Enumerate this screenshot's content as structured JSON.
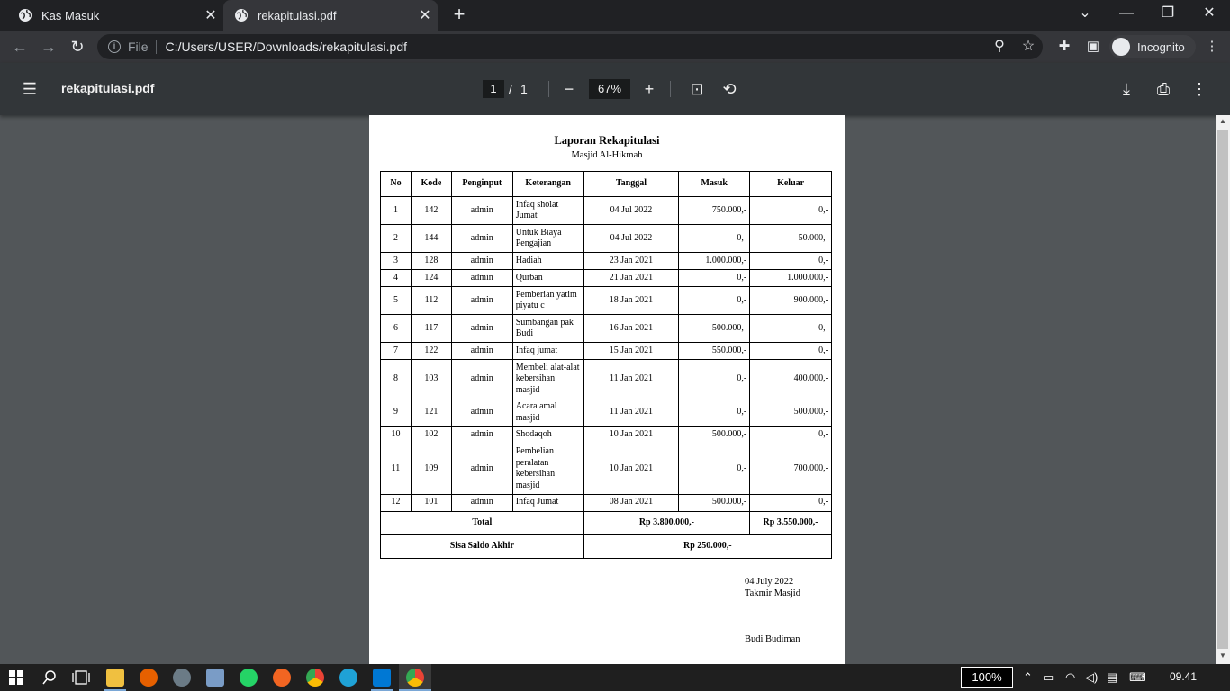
{
  "browser": {
    "tabs": [
      {
        "title": "Kas Masuk",
        "active": false
      },
      {
        "title": "rekapitulasi.pdf",
        "active": true
      }
    ],
    "omnibox": {
      "prefix": "File",
      "url": "C:/Users/USER/Downloads/rekapitulasi.pdf"
    },
    "profile_label": "Incognito"
  },
  "viewer": {
    "title": "rekapitulasi.pdf",
    "page_current": "1",
    "page_sep": "/",
    "page_total": "1",
    "zoom": "67%"
  },
  "document": {
    "title": "Laporan Rekapitulasi",
    "subtitle": "Masjid Al-Hikmah",
    "columns": [
      "No",
      "Kode",
      "Penginput",
      "Keterangan",
      "Tanggal",
      "Masuk",
      "Keluar"
    ],
    "rows": [
      {
        "no": "1",
        "kode": "142",
        "penginput": "admin",
        "keterangan": "Infaq sholat Jumat",
        "tanggal": "04 Jul 2022",
        "masuk": "750.000,-",
        "keluar": "0,-"
      },
      {
        "no": "2",
        "kode": "144",
        "penginput": "admin",
        "keterangan": "Untuk Biaya Pengajian",
        "tanggal": "04 Jul 2022",
        "masuk": "0,-",
        "keluar": "50.000,-"
      },
      {
        "no": "3",
        "kode": "128",
        "penginput": "admin",
        "keterangan": "Hadiah",
        "tanggal": "23 Jan 2021",
        "masuk": "1.000.000,-",
        "keluar": "0,-"
      },
      {
        "no": "4",
        "kode": "124",
        "penginput": "admin",
        "keterangan": "Qurban",
        "tanggal": "21 Jan 2021",
        "masuk": "0,-",
        "keluar": "1.000.000,-"
      },
      {
        "no": "5",
        "kode": "112",
        "penginput": "admin",
        "keterangan": "Pemberian yatim piyatu c",
        "tanggal": "18 Jan 2021",
        "masuk": "0,-",
        "keluar": "900.000,-"
      },
      {
        "no": "6",
        "kode": "117",
        "penginput": "admin",
        "keterangan": "Sumbangan pak Budi",
        "tanggal": "16 Jan 2021",
        "masuk": "500.000,-",
        "keluar": "0,-"
      },
      {
        "no": "7",
        "kode": "122",
        "penginput": "admin",
        "keterangan": "Infaq jumat",
        "tanggal": "15 Jan 2021",
        "masuk": "550.000,-",
        "keluar": "0,-"
      },
      {
        "no": "8",
        "kode": "103",
        "penginput": "admin",
        "keterangan": "Membeli alat-alat kebersihan masjid",
        "tanggal": "11 Jan 2021",
        "masuk": "0,-",
        "keluar": "400.000,-"
      },
      {
        "no": "9",
        "kode": "121",
        "penginput": "admin",
        "keterangan": "Acara amal masjid",
        "tanggal": "11 Jan 2021",
        "masuk": "0,-",
        "keluar": "500.000,-"
      },
      {
        "no": "10",
        "kode": "102",
        "penginput": "admin",
        "keterangan": "Shodaqoh",
        "tanggal": "10 Jan 2021",
        "masuk": "500.000,-",
        "keluar": "0,-"
      },
      {
        "no": "11",
        "kode": "109",
        "penginput": "admin",
        "keterangan": "Pembelian peralatan kebersihan masjid",
        "tanggal": "10 Jan 2021",
        "masuk": "0,-",
        "keluar": "700.000,-"
      },
      {
        "no": "12",
        "kode": "101",
        "penginput": "admin",
        "keterangan": "Infaq Jumat",
        "tanggal": "08 Jan 2021",
        "masuk": "500.000,-",
        "keluar": "0,-"
      }
    ],
    "total_label": "Total",
    "total_masuk": "Rp 3.800.000,-",
    "total_keluar": "Rp 3.550.000,-",
    "saldo_label": "Sisa Saldo Akhir",
    "saldo_value": "Rp 250.000,-",
    "sign_date": "04 July 2022",
    "sign_role": "Takmir Masjid",
    "sign_name": "Budi Budiman"
  },
  "taskbar": {
    "keyboard_zoom": "100%",
    "clock": "09.41"
  }
}
